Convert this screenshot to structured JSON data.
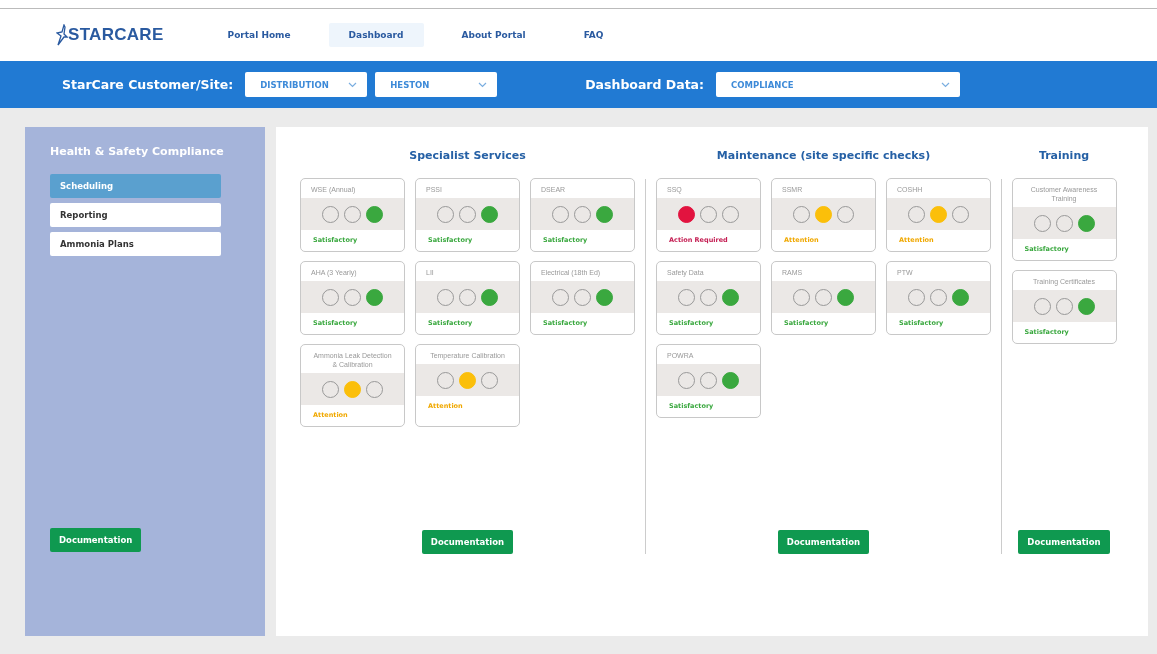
{
  "logo": "STARCARE",
  "nav": [
    {
      "label": "Portal Home",
      "selected": false
    },
    {
      "label": "Dashboard",
      "selected": true
    },
    {
      "label": "About Portal",
      "selected": false
    },
    {
      "label": "FAQ",
      "selected": false
    }
  ],
  "filter_bar": {
    "site_label": "StarCare Customer/Site:",
    "customer": "DISTRIBUTION",
    "site": "HESTON",
    "data_label": "Dashboard Data:",
    "data": "COMPLIANCE"
  },
  "sidebar": {
    "title": "Health & Safety Compliance",
    "items": [
      {
        "label": "Scheduling",
        "selected": true
      },
      {
        "label": "Reporting",
        "selected": false
      },
      {
        "label": "Ammonia Plans",
        "selected": false
      }
    ],
    "button": "Documentation"
  },
  "sections": [
    {
      "title": "Specialist Services",
      "button": "Documentation",
      "cards": [
        {
          "title": "WSE (Annual)",
          "kind": "green",
          "label": "Satisfactory"
        },
        {
          "title": "PSSI",
          "kind": "green",
          "label": "Satisfactory"
        },
        {
          "title": "DSEAR",
          "kind": "green",
          "label": "Satisfactory"
        },
        {
          "title": "AHA (3 Yearly)",
          "kind": "green",
          "label": "Satisfactory"
        },
        {
          "title": "LII",
          "kind": "green",
          "label": "Satisfactory"
        },
        {
          "title": "Electrical (18th Ed)",
          "kind": "green",
          "label": "Satisfactory"
        },
        {
          "title": "Ammonia Leak Detection & Calibration",
          "kind": "amber",
          "label": "Attention"
        },
        {
          "title": "Temperature Calibration",
          "kind": "amber",
          "label": "Attention"
        }
      ]
    },
    {
      "title": "Maintenance (site specific checks)",
      "button": "Documentation",
      "cards": [
        {
          "title": "SSQ",
          "kind": "red",
          "label": "Action Required"
        },
        {
          "title": "SSMR",
          "kind": "amber",
          "label": "Attention"
        },
        {
          "title": "COSHH",
          "kind": "amber",
          "label": "Attention"
        },
        {
          "title": "Safety Data",
          "kind": "green",
          "label": "Satisfactory"
        },
        {
          "title": "RAMS",
          "kind": "green",
          "label": "Satisfactory"
        },
        {
          "title": "PTW",
          "kind": "green",
          "label": "Satisfactory"
        },
        {
          "title": "POWRA",
          "kind": "green",
          "label": "Satisfactory"
        }
      ]
    },
    {
      "title": "Training",
      "button": "Documentation",
      "cards": [
        {
          "title": "Customer Awareness Training",
          "kind": "green",
          "label": "Satisfactory"
        },
        {
          "title": "Training Certificates",
          "kind": "green",
          "label": "Satisfactory"
        }
      ]
    }
  ]
}
